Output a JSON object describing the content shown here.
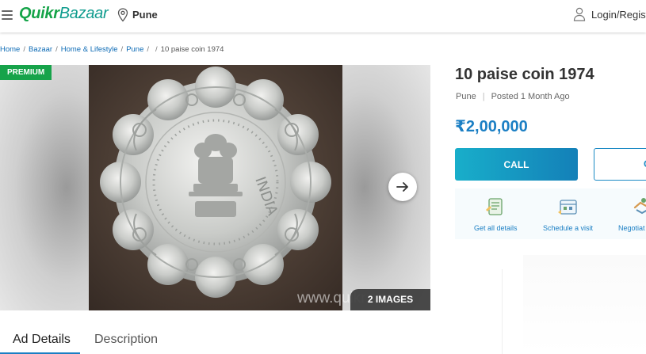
{
  "header": {
    "logo_part1": "Quikr",
    "logo_part2": "Bazaar",
    "location": "Pune",
    "login": "Login/Regist"
  },
  "breadcrumb": {
    "items": [
      "Home",
      "Bazaar",
      "Home & Lifestyle",
      "Pune",
      ""
    ],
    "current": "10 paise coin 1974"
  },
  "gallery": {
    "badge": "PREMIUM",
    "images_count": "2 IMAGES",
    "watermark": "www.quikr.com",
    "coin_text": "INDIA"
  },
  "tabs": {
    "items": [
      "Ad Details",
      "Description"
    ],
    "active": "Ad Details"
  },
  "listing": {
    "title": "10 paise coin 1974",
    "location": "Pune",
    "posted": "Posted 1 Month Ago",
    "price": "₹2,00,000"
  },
  "buttons": {
    "call": "CALL",
    "chat": "C"
  },
  "actions": [
    {
      "label": "Get all details",
      "icon": "document-icon"
    },
    {
      "label": "Schedule a visit",
      "icon": "calendar-icon"
    },
    {
      "label": "Negotiat",
      "icon": "handshake-icon"
    }
  ],
  "colors": {
    "brand_green": "#15a449",
    "price_blue": "#1b7fc4",
    "premium_green": "#16a34a"
  }
}
